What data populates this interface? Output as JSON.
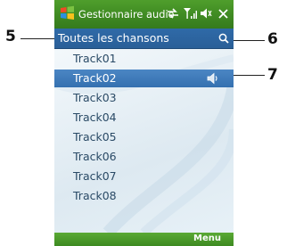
{
  "titlebar": {
    "title": "Gestionnaire audio",
    "icons": [
      "windows-start-icon",
      "sync-arrows-icon",
      "signal-icon",
      "volume-icon",
      "close-icon"
    ]
  },
  "list_header": {
    "label": "Toutes les chansons",
    "search_icon": "search-icon"
  },
  "tracks": [
    "Track01",
    "Track02",
    "Track03",
    "Track04",
    "Track05",
    "Track06",
    "Track07",
    "Track08"
  ],
  "selected_track": "Track02",
  "softkeys": {
    "right": "Menu"
  },
  "callouts": [
    "5",
    "6",
    "7"
  ],
  "colors": {
    "titlebar_green": "#3f8a22",
    "header_blue": "#2f6aa8",
    "selection_blue": "#3f7bbb",
    "list_text": "#2a4a66"
  }
}
